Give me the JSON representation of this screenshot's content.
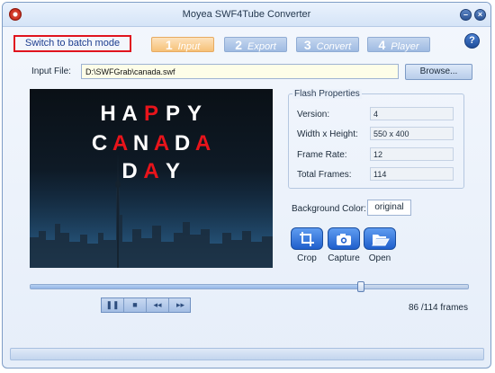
{
  "window": {
    "title": "Moyea SWF4Tube Converter",
    "minimize_glyph": "–",
    "close_glyph": "×"
  },
  "toolbar": {
    "batch_label": "Switch to batch mode",
    "steps": [
      {
        "num": "1",
        "label": "Input",
        "active": true
      },
      {
        "num": "2",
        "label": "Export",
        "active": false
      },
      {
        "num": "3",
        "label": "Convert",
        "active": false
      },
      {
        "num": "4",
        "label": "Player",
        "active": false
      }
    ],
    "help_glyph": "?"
  },
  "input": {
    "label": "Input File:",
    "value": "D:\\SWFGrab\\canada.swf",
    "browse_label": "Browse..."
  },
  "preview": {
    "line1": [
      "H",
      "A",
      "P",
      "P",
      "Y"
    ],
    "line1_red_indices": [
      2
    ],
    "line2": [
      "C",
      "A",
      "N",
      "A",
      "D",
      "A"
    ],
    "line2_red_indices": [
      1,
      3,
      5
    ],
    "line3": [
      "D",
      "A",
      "Y"
    ],
    "line3_red_indices": [
      1
    ],
    "text_color": "#ffffff",
    "accent_color": "#e8141b"
  },
  "flash_properties": {
    "title": "Flash Properties",
    "rows": [
      {
        "label": "Version:",
        "value": "4"
      },
      {
        "label": "Width x Height:",
        "value": "550 x 400"
      },
      {
        "label": "Frame Rate:",
        "value": "12"
      },
      {
        "label": "Total Frames:",
        "value": "114"
      }
    ]
  },
  "background": {
    "label": "Background Color:",
    "value": "original"
  },
  "tools": [
    {
      "label": "Crop",
      "icon": "crop-icon"
    },
    {
      "label": "Capture",
      "icon": "camera-icon"
    },
    {
      "label": "Open",
      "icon": "folder-open-icon"
    }
  ],
  "playback": {
    "current_frame": 86,
    "total_frames": 114,
    "frames_text": "86 /114 frames",
    "buttons": [
      {
        "name": "pause",
        "glyph": "❚❚"
      },
      {
        "name": "stop",
        "glyph": "■"
      },
      {
        "name": "rewind",
        "glyph": "◂◂"
      },
      {
        "name": "forward",
        "glyph": "▸▸"
      }
    ]
  },
  "colors": {
    "accent_red": "#e0141e",
    "active_step": "#f6c178",
    "tool_blue": "#1f5fcc"
  }
}
